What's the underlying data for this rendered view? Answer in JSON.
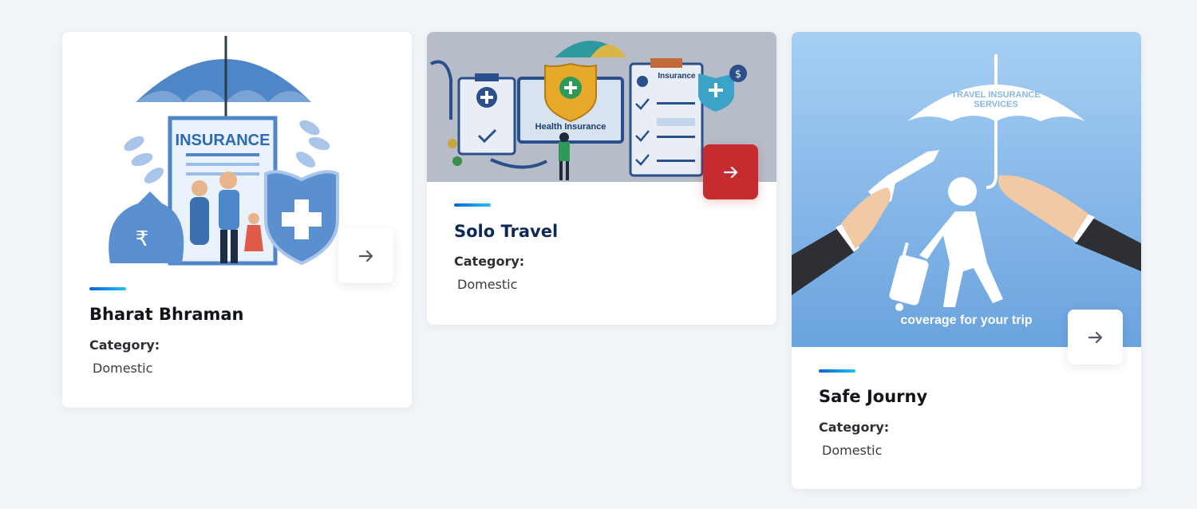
{
  "cards": [
    {
      "title": "Bharat Bhraman",
      "category_label": "Category:",
      "category_value": "Domestic",
      "image_text": "INSURANCE",
      "currency_symbol": "₹"
    },
    {
      "title": "Solo Travel",
      "category_label": "Category:",
      "category_value": "Domestic",
      "image_text": "Health Insurance",
      "image_text_2": "Insurance",
      "currency_symbol": "$"
    },
    {
      "title": "Safe Journy",
      "category_label": "Category:",
      "category_value": "Domestic",
      "image_text": "TRAVEL INSURANCE",
      "image_text_2": "SERVICES",
      "image_caption": "coverage for your trip"
    }
  ],
  "icons": {
    "arrow": "arrow-right-icon"
  },
  "colors": {
    "background": "#f1f4f8",
    "active_button": "#c62b2f",
    "title_hover": "#0d2a55",
    "accent_start": "#0a63d6",
    "accent_end": "#21c2ef"
  }
}
